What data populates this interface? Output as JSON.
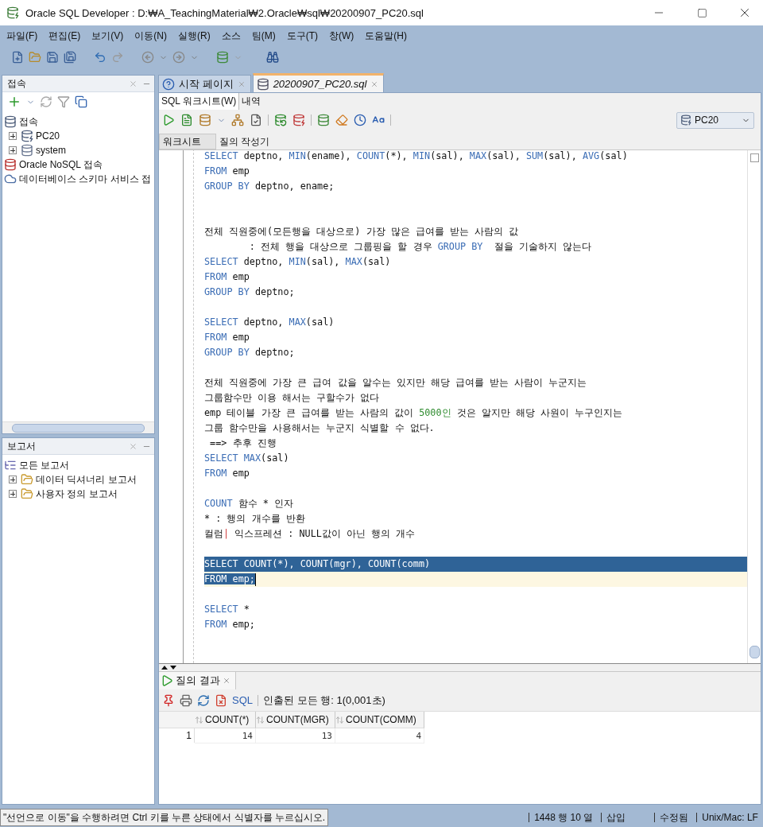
{
  "window": {
    "title": "Oracle SQL Developer : D:₩A_TeachingMaterial₩2.Oracle₩sql₩20200907_PC20.sql"
  },
  "menu": [
    "파일(F)",
    "편집(E)",
    "보기(V)",
    "이동(N)",
    "실행(R)",
    "소스",
    "팀(M)",
    "도구(T)",
    "창(W)",
    "도움말(H)"
  ],
  "connections_panel": {
    "title": "접속",
    "tree": [
      {
        "label": "접속",
        "kind": "connections",
        "children": [
          {
            "label": "PC20",
            "kind": "connection",
            "expanded": false
          },
          {
            "label": "system",
            "kind": "database",
            "expanded": false
          }
        ]
      },
      {
        "label": "Oracle NoSQL 접속",
        "kind": "nosql"
      },
      {
        "label": "데이터베이스 스키마 서비스 접",
        "kind": "cloud"
      }
    ]
  },
  "reports_panel": {
    "title": "보고서",
    "tree": [
      {
        "label": "모든 보고서",
        "kind": "reports",
        "children": [
          {
            "label": "데이터 딕셔너리 보고서",
            "kind": "folder",
            "expanded": false
          },
          {
            "label": "사용자 정의 보고서",
            "kind": "folder",
            "expanded": false
          }
        ]
      }
    ]
  },
  "document_tabs": [
    {
      "label": "시작 페이지",
      "kind": "help",
      "selected": false
    },
    {
      "label": "20200907_PC20.sql",
      "kind": "sql",
      "selected": true
    }
  ],
  "sub_tabs": [
    {
      "label": "SQL 워크시트(W)",
      "selected": true
    },
    {
      "label": "내역",
      "selected": false
    }
  ],
  "connection_selector": {
    "value": "PC20"
  },
  "worksheet_tabs": [
    {
      "label": "워크시트",
      "selected": true
    },
    {
      "label": "질의 작성기",
      "selected": false
    }
  ],
  "editor_lines": [
    {
      "selected": false,
      "current": false,
      "segments": [
        {
          "kind": "kw",
          "text": "SELECT"
        },
        {
          "kind": "plain",
          "text": " deptno, "
        },
        {
          "kind": "kw",
          "text": "MIN"
        },
        {
          "kind": "plain",
          "text": "(ename), "
        },
        {
          "kind": "kw",
          "text": "COUNT"
        },
        {
          "kind": "plain",
          "text": "(*), "
        },
        {
          "kind": "kw",
          "text": "MIN"
        },
        {
          "kind": "plain",
          "text": "(sal), "
        },
        {
          "kind": "kw",
          "text": "MAX"
        },
        {
          "kind": "plain",
          "text": "(sal), "
        },
        {
          "kind": "kw",
          "text": "SUM"
        },
        {
          "kind": "plain",
          "text": "(sal), "
        },
        {
          "kind": "kw",
          "text": "AVG"
        },
        {
          "kind": "plain",
          "text": "(sal)"
        }
      ]
    },
    {
      "selected": false,
      "current": false,
      "segments": [
        {
          "kind": "kw",
          "text": "FROM"
        },
        {
          "kind": "plain",
          "text": " emp"
        }
      ]
    },
    {
      "selected": false,
      "current": false,
      "segments": [
        {
          "kind": "kw",
          "text": "GROUP BY"
        },
        {
          "kind": "plain",
          "text": " deptno, ename;"
        }
      ]
    },
    {
      "selected": false,
      "current": false
    },
    {
      "selected": false,
      "current": false
    },
    {
      "selected": false,
      "current": false,
      "segments": [
        {
          "kind": "plain",
          "text": "전체 직원중에(모든행을 대상으로) 가장 많은 급여를 받는 사람의 값"
        }
      ]
    },
    {
      "selected": false,
      "current": false,
      "segments": [
        {
          "kind": "plain",
          "text": "        : 전체 행을 대상으로 그룹핑을 할 경우 "
        },
        {
          "kind": "kw",
          "text": "GROUP BY"
        },
        {
          "kind": "plain",
          "text": "  절을 기술하지 않는다"
        }
      ]
    },
    {
      "selected": false,
      "current": false,
      "segments": [
        {
          "kind": "kw",
          "text": "SELECT"
        },
        {
          "kind": "plain",
          "text": " deptno, "
        },
        {
          "kind": "kw",
          "text": "MIN"
        },
        {
          "kind": "plain",
          "text": "(sal), "
        },
        {
          "kind": "kw",
          "text": "MAX"
        },
        {
          "kind": "plain",
          "text": "(sal)"
        }
      ]
    },
    {
      "selected": false,
      "current": false,
      "segments": [
        {
          "kind": "kw",
          "text": "FROM"
        },
        {
          "kind": "plain",
          "text": " emp"
        }
      ]
    },
    {
      "selected": false,
      "current": false,
      "segments": [
        {
          "kind": "kw",
          "text": "GROUP BY"
        },
        {
          "kind": "plain",
          "text": " deptno;"
        }
      ]
    },
    {
      "selected": false,
      "current": false
    },
    {
      "selected": false,
      "current": false,
      "segments": [
        {
          "kind": "kw",
          "text": "SELECT"
        },
        {
          "kind": "plain",
          "text": " deptno, "
        },
        {
          "kind": "kw",
          "text": "MAX"
        },
        {
          "kind": "plain",
          "text": "(sal)"
        }
      ]
    },
    {
      "selected": false,
      "current": false,
      "segments": [
        {
          "kind": "kw",
          "text": "FROM"
        },
        {
          "kind": "plain",
          "text": " emp"
        }
      ]
    },
    {
      "selected": false,
      "current": false,
      "segments": [
        {
          "kind": "kw",
          "text": "GROUP BY"
        },
        {
          "kind": "plain",
          "text": " deptno;"
        }
      ]
    },
    {
      "selected": false,
      "current": false
    },
    {
      "selected": false,
      "current": false,
      "segments": [
        {
          "kind": "plain",
          "text": "전체 직원중에 가장 큰 급여 값을 알수는 있지만 해당 급여를 받는 사람이 누군지는"
        }
      ]
    },
    {
      "selected": false,
      "current": false,
      "segments": [
        {
          "kind": "plain",
          "text": "그룹함수만 이용 해서는 구할수가 없다"
        }
      ]
    },
    {
      "selected": false,
      "current": false,
      "segments": [
        {
          "kind": "plain",
          "text": "emp 테이블 가장 큰 급여를 받는 사람의 값이 "
        },
        {
          "kind": "num",
          "text": "5000인"
        },
        {
          "kind": "plain",
          "text": " 것은 알지만 해당 사원이 누구인지는"
        }
      ]
    },
    {
      "selected": false,
      "current": false,
      "segments": [
        {
          "kind": "plain",
          "text": "그룹 함수만을 사용해서는 누군지 식별할 수 없다."
        }
      ]
    },
    {
      "selected": false,
      "current": false,
      "segments": [
        {
          "kind": "plain",
          "text": " ==> 추후 진행"
        }
      ]
    },
    {
      "selected": false,
      "current": false,
      "segments": [
        {
          "kind": "kw",
          "text": "SELECT MAX"
        },
        {
          "kind": "plain",
          "text": "(sal)"
        }
      ]
    },
    {
      "selected": false,
      "current": false,
      "segments": [
        {
          "kind": "kw",
          "text": "FROM"
        },
        {
          "kind": "plain",
          "text": " emp"
        }
      ]
    },
    {
      "selected": false,
      "current": false
    },
    {
      "selected": false,
      "current": false,
      "segments": [
        {
          "kind": "kw",
          "text": "COUNT"
        },
        {
          "kind": "plain",
          "text": " 함수 * 인자"
        }
      ]
    },
    {
      "selected": false,
      "current": false,
      "segments": [
        {
          "kind": "plain",
          "text": "* : 행의 개수를 반환"
        }
      ]
    },
    {
      "selected": false,
      "current": false,
      "segments": [
        {
          "kind": "plain",
          "text": "컬럼"
        },
        {
          "kind": "mark",
          "text": "|"
        },
        {
          "kind": "plain",
          "text": " 익스프레션 : NULL값이 아닌 행의 개수"
        }
      ]
    },
    {
      "selected": false,
      "current": false
    },
    {
      "selected": true,
      "current": false,
      "segments": [
        {
          "kind": "kw",
          "text": "SELECT COUNT"
        },
        {
          "kind": "plain",
          "text": "(*), "
        },
        {
          "kind": "kw",
          "text": "COUNT"
        },
        {
          "kind": "plain",
          "text": "(mgr), "
        },
        {
          "kind": "kw",
          "text": "COUNT"
        },
        {
          "kind": "plain",
          "text": "(comm)"
        }
      ]
    },
    {
      "selected": true,
      "current": true,
      "segments": [
        {
          "kind": "kw",
          "text": "FROM"
        },
        {
          "kind": "plain",
          "text": " emp;"
        }
      ]
    },
    {
      "selected": false,
      "current": false
    },
    {
      "selected": false,
      "current": false,
      "segments": [
        {
          "kind": "kw",
          "text": "SELECT"
        },
        {
          "kind": "plain",
          "text": " *"
        }
      ]
    },
    {
      "selected": false,
      "current": false,
      "segments": [
        {
          "kind": "kw",
          "text": "FROM"
        },
        {
          "kind": "plain",
          "text": " emp;"
        }
      ]
    }
  ],
  "results": {
    "tab": "질의 결과",
    "sql_link": "SQL",
    "fetch_info": "인출된 모든 행: 1(0,001초)",
    "columns": [
      "COUNT(*)",
      "COUNT(MGR)",
      "COUNT(COMM)"
    ],
    "rows": [
      {
        "number": "1",
        "cells": [
          "14",
          "13",
          "4"
        ]
      }
    ]
  },
  "status_bar": {
    "message": "\"선언으로 이동\"을 수행하려면 Ctrl 키를 누른 상태에서 식별자를 누르십시오.",
    "items": [
      "1448 행 10 열",
      "삽입",
      "수정됨",
      "Unix/Mac: LF"
    ]
  }
}
